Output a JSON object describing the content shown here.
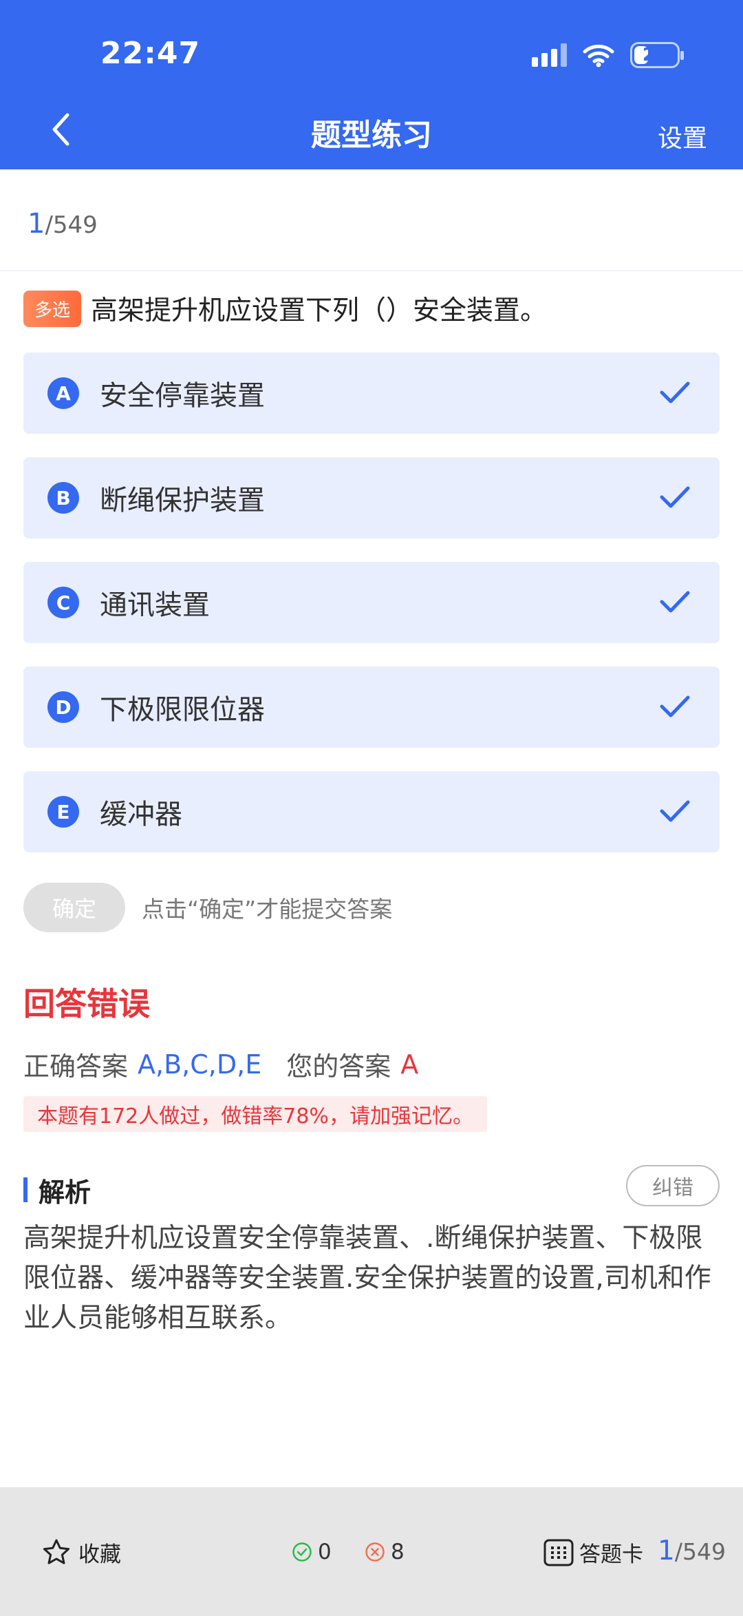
{
  "status": {
    "time": "22:47",
    "battery": "21"
  },
  "nav": {
    "title": "题型练习",
    "settings": "设置"
  },
  "progress": {
    "current": "1",
    "total": "/549"
  },
  "question": {
    "type_tag": "多选",
    "text": "高架提升机应设置下列（）安全装置。",
    "options": [
      {
        "letter": "A",
        "text": "安全停靠装置",
        "selected": true
      },
      {
        "letter": "B",
        "text": "断绳保护装置",
        "selected": true
      },
      {
        "letter": "C",
        "text": "通讯装置",
        "selected": true
      },
      {
        "letter": "D",
        "text": "下极限限位器",
        "selected": true
      },
      {
        "letter": "E",
        "text": "缓冲器",
        "selected": true
      }
    ]
  },
  "confirm": {
    "label": "确定",
    "hint": "点击“确定”才能提交答案"
  },
  "result": {
    "title": "回答错误",
    "correct_label": "正确答案",
    "correct_value": "A,B,C,D,E",
    "mine_label": "您的答案",
    "mine_value": "A",
    "error_note": "本题有172人做过，做错率78%，请加强记忆。"
  },
  "analysis": {
    "title": "解析",
    "report_label": "纠错",
    "text": "高架提升机应设置安全停靠装置、.断绳保护装置、下极限限位器、缓冲器等安全装置.安全保护装置的设置,司机和作业人员能够相互联系。"
  },
  "bottom": {
    "favorite_label": "收藏",
    "correct_count": "0",
    "wrong_count": "8",
    "card_label": "答题卡",
    "current": "1",
    "total": "/549"
  },
  "colors": {
    "primary": "#3469f0",
    "error": "#e8353a",
    "correct": "#2fb84a"
  }
}
